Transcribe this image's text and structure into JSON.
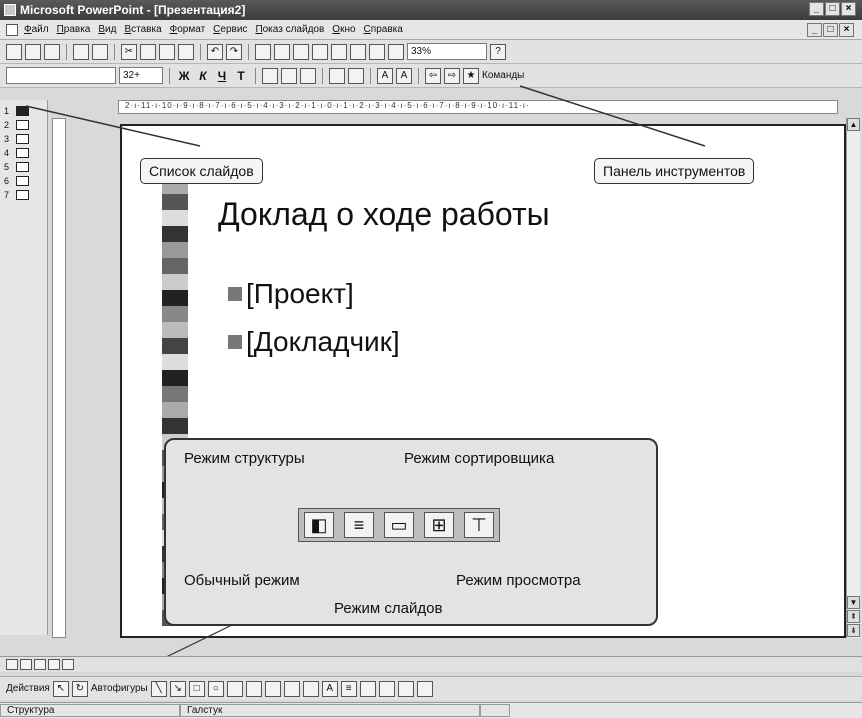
{
  "window": {
    "title": "Microsoft PowerPoint - [Презентация2]",
    "controls": [
      "_",
      "□",
      "×"
    ]
  },
  "menu": {
    "items": [
      "Файл",
      "Правка",
      "Вид",
      "Вставка",
      "Формат",
      "Сервис",
      "Показ слайдов",
      "Окно",
      "Справка"
    ]
  },
  "toolbar": {
    "zoom": "33%",
    "help_button": "?",
    "font_size": "32+",
    "commands_label": "Команды",
    "format_buttons": [
      "Ж",
      "К",
      "Ч",
      "Т"
    ]
  },
  "ruler": {
    "labels": "2·ı·11·ı·10·ı·9·ı·8·ı·7·ı·6·ı·5·ı·4·ı·3·ı·2·ı·1·ı·0·ı·1·ı·2·ı·3·ı·4·ı·5·ı·6·ı·7·ı·8·ı·9·ı·10·ı·11·ı·"
  },
  "slide_list": {
    "numbers": [
      "1",
      "2",
      "3",
      "4",
      "5",
      "6",
      "7"
    ]
  },
  "slide": {
    "title": "Доклад о ходе работы",
    "bullets": [
      "[Проект]",
      "[Докладчик]"
    ]
  },
  "callouts": {
    "slide_list": "Список слайдов",
    "toolbar": "Панель инструментов"
  },
  "view_modes": {
    "outline": "Режим структуры",
    "sorter": "Режим сортировщика",
    "normal": "Обычный режим",
    "show": "Режим просмотра",
    "slides": "Режим слайдов"
  },
  "drawing_toolbar": {
    "actions": "Действия",
    "autoshapes": "Автофигуры"
  },
  "status": {
    "view": "Структура",
    "design": "Галстук"
  },
  "icons": [
    "new-icon",
    "open-icon",
    "save-icon",
    "print-icon",
    "spell-icon",
    "cut-icon",
    "copy-icon",
    "paste-icon",
    "undo-icon",
    "redo-icon",
    "pointer-icon",
    "line-icon",
    "rectangle-icon",
    "oval-icon"
  ]
}
